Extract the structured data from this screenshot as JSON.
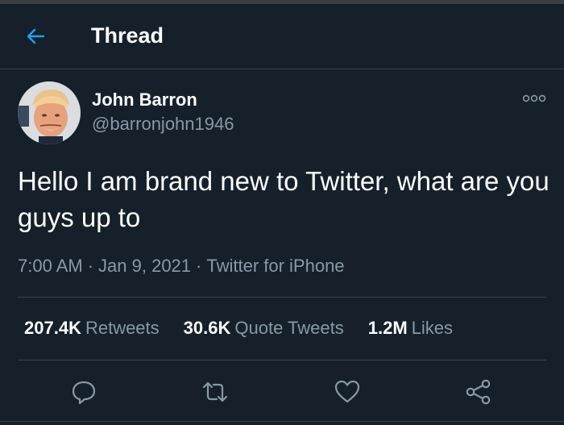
{
  "header": {
    "title": "Thread",
    "back_icon": "arrow-left-icon",
    "accent_color": "#1da1f2"
  },
  "tweet": {
    "author": {
      "display_name": "John Barron",
      "handle": "@barronjohn1946",
      "avatar": "profile-photo"
    },
    "text": "Hello I am brand new to Twitter, what are you guys up to",
    "time": "7:00 AM",
    "date": "Jan 9, 2021",
    "separator": "·",
    "source": "Twitter for iPhone",
    "stats": [
      {
        "value": "207.4K",
        "label": "Retweets"
      },
      {
        "value": "30.6K",
        "label": "Quote Tweets"
      },
      {
        "value": "1.2M",
        "label": "Likes"
      }
    ],
    "actions": [
      {
        "name": "reply",
        "icon": "reply-bubble-icon"
      },
      {
        "name": "retweet",
        "icon": "retweet-icon"
      },
      {
        "name": "like",
        "icon": "heart-icon"
      },
      {
        "name": "share",
        "icon": "share-icon"
      }
    ]
  },
  "colors": {
    "background": "#15202b",
    "text_primary": "#ffffff",
    "text_secondary": "#8899a6",
    "divider": "#38444d"
  }
}
